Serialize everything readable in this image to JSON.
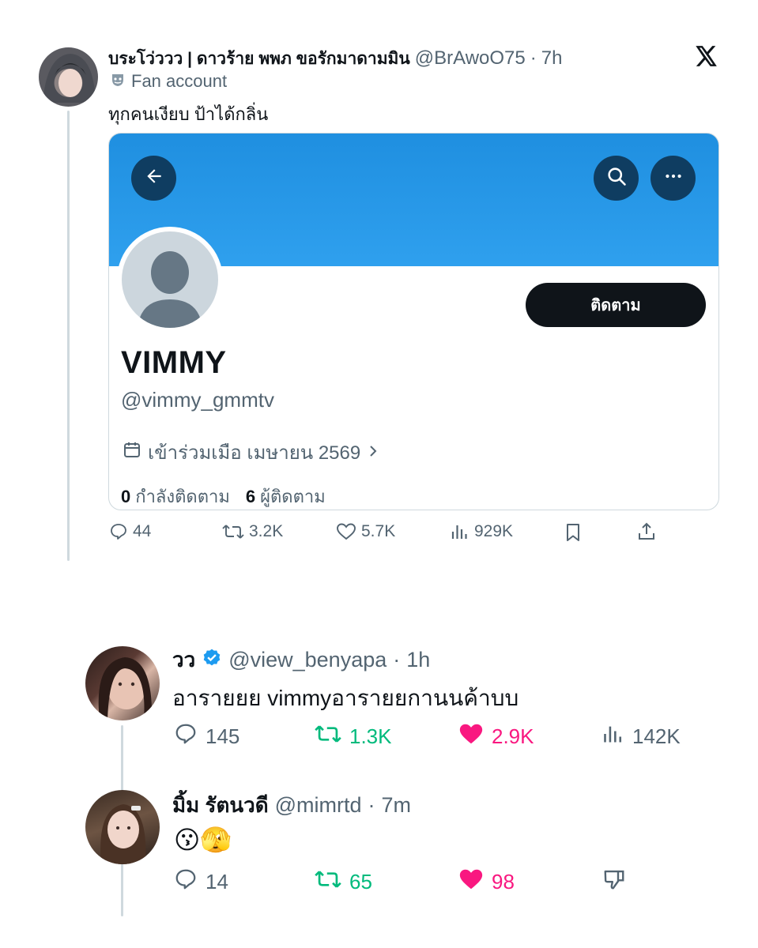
{
  "tweet": {
    "author_name": "บระโว่ววว | ดาวร้าย พพภ ขอรักมาดามมิน",
    "handle": "@BrAwoO75",
    "time": "7h",
    "badge": "Fan account",
    "text": "ทุกคนเงียบ ป้าได้กลิ่น",
    "stats": {
      "replies": "44",
      "retweets": "3.2K",
      "likes": "5.7K",
      "views": "929K"
    }
  },
  "profile_card": {
    "follow_label": "ติดตาม",
    "display_name": "VIMMY",
    "username": "@vimmy_gmmtv",
    "joined": "เข้าร่วมเมือ เมษายน 2569",
    "following_count": "0",
    "following_label": "กำลังติดตาม",
    "followers_count": "6",
    "followers_label": "ผู้ติดตาม",
    "banner_color": "#2196e8"
  },
  "replies": [
    {
      "name": "วว",
      "handle": "@view_benyapa",
      "time": "1h",
      "verified": true,
      "text": "อารายยย vimmyอารายยกานนค้าบบ",
      "stats": {
        "replies": "145",
        "retweets": "1.3K",
        "likes": "2.9K",
        "views": "142K"
      }
    },
    {
      "name": "มิ้ม รัตนวดี",
      "handle": "@mimrtd",
      "time": "7m",
      "text": "😗🫣",
      "stats": {
        "replies": "14",
        "retweets": "65",
        "likes": "98"
      }
    }
  ],
  "colors": {
    "like": "#f91880",
    "retweet": "#00ba7c",
    "verified": "#1d9bf0",
    "muted": "#536471"
  }
}
